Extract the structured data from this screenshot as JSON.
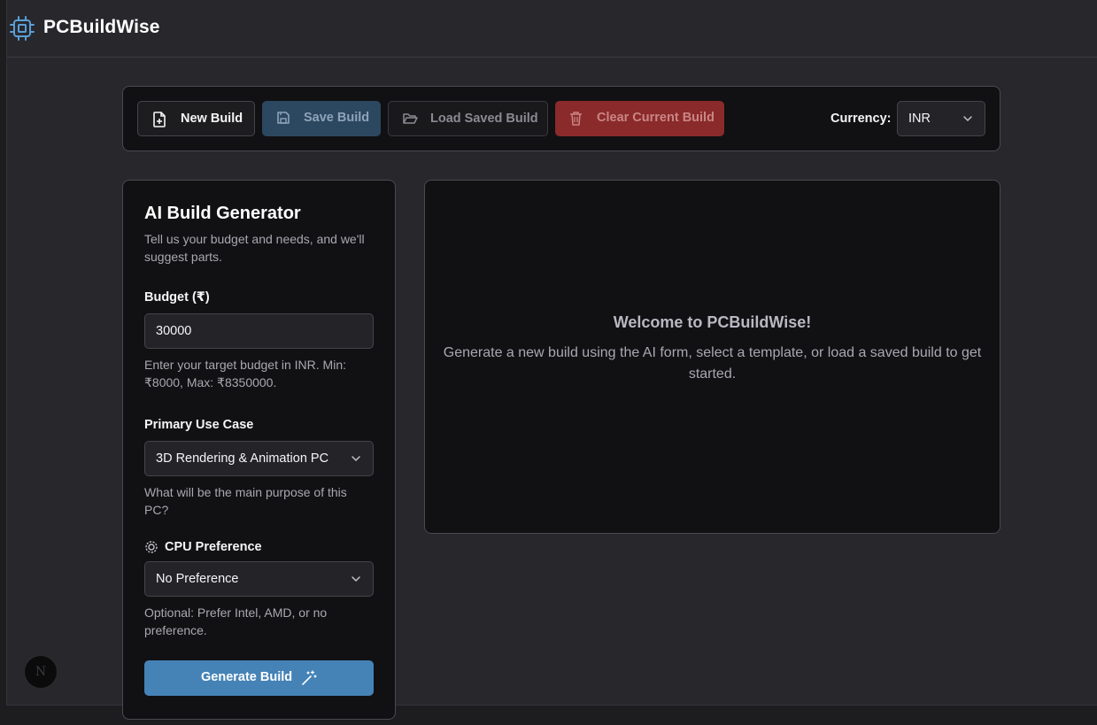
{
  "brand": {
    "name": "PCBuildWise",
    "icon": "cpu-chip-icon",
    "accent": "#5a9fd6"
  },
  "toolbar": {
    "new_label": "New Build",
    "save_label": "Save Build",
    "load_label": "Load Saved Build",
    "clear_label": "Clear Current Build",
    "currency_label": "Currency:",
    "currency_value": "INR"
  },
  "generator": {
    "title": "AI Build Generator",
    "subtitle": "Tell us your budget and needs, and we'll suggest parts.",
    "budget_label": "Budget (₹)",
    "budget_value": "30000",
    "budget_help": "Enter your target budget in INR. Min: ₹8000, Max: ₹8350000.",
    "use_case_label": "Primary Use Case",
    "use_case_value": "3D Rendering & Animation PC",
    "use_case_help": "What will be the main purpose of this PC?",
    "cpu_label": "CPU Preference",
    "cpu_value": "No Preference",
    "cpu_help": "Optional: Prefer Intel, AMD, or no preference.",
    "generate_label": "Generate Build",
    "generate_color": "#4583b7"
  },
  "welcome": {
    "title": "Welcome to PCBuildWise!",
    "text": "Generate a new build using the AI form, select a template, or load a saved build to get started."
  },
  "fab": {
    "label": "N"
  },
  "colors": {
    "danger": "#8a2a2b",
    "save": "#2c4760",
    "card_bg": "#111113",
    "page_bg": "#28272c"
  }
}
